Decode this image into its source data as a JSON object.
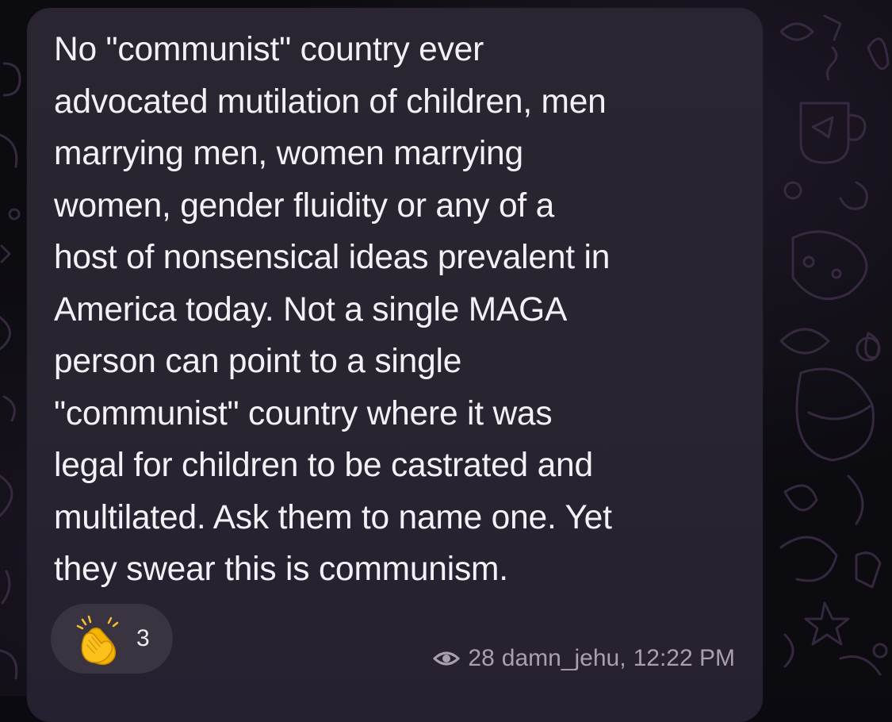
{
  "message": {
    "text": "No \"communist\" country ever\nadvocated mutilation of children, men\nmarrying men, women marrying\nwomen, gender fluidity or any of a\nhost of nonsensical ideas prevalent in\nAmerica today. Not a single MAGA\nperson can point to a single\n\"communist\" country where it was\nlegal for children to be castrated and\nmultilated. Ask them to name one. Yet\nthey swear this is communism.",
    "reaction": {
      "emoji_icon": "clapping-hands-icon",
      "count": "3"
    },
    "views": "28",
    "author": "damn_jehu,",
    "time": "12:22 PM",
    "view_icon": "eye-icon"
  },
  "colors": {
    "bubble": "#2a2530",
    "text": "#f3f1f5",
    "meta": "#a8a1ad",
    "reaction_bg": "#3a3440",
    "background": "#0c0b10"
  }
}
